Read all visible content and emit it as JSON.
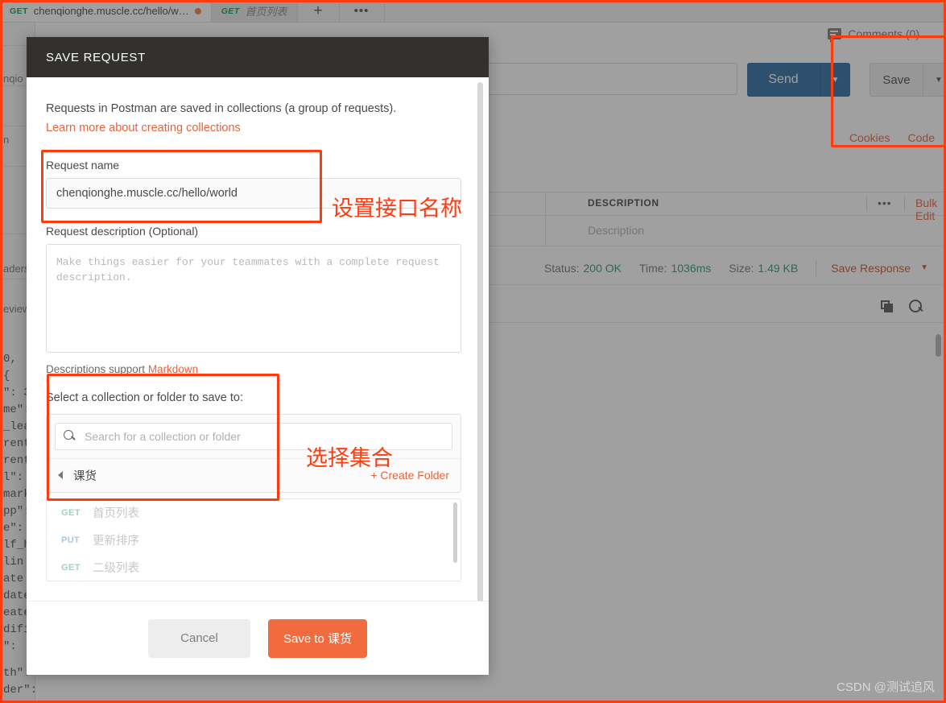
{
  "app": {
    "tabs": [
      {
        "method": "GET",
        "label": "chenqionghe.muscle.cc/hello/w…",
        "unsaved": true
      },
      {
        "method": "GET",
        "label": "首页列表",
        "unsaved": false
      }
    ],
    "new_tab_icon": "plus-icon",
    "tab_options_icon": "ellipsis-icon",
    "sidebar_fragments": [
      "nqio",
      "n",
      "aders",
      "eview"
    ],
    "url_placeholder": "",
    "send_label": "Send",
    "save_label": "Save",
    "comments_label": "Comments (0)",
    "cookies_label": "Cookies",
    "code_label": "Code",
    "table": {
      "header_description": "DESCRIPTION",
      "header_more": "•••",
      "bulk_edit": "Bulk Edit",
      "row_description_placeholder": "Description"
    },
    "status": {
      "status_label": "Status:",
      "status_value": "200 OK",
      "time_label": "Time:",
      "time_value": "1036ms",
      "size_label": "Size:",
      "size_value": "1.49 KB",
      "save_response": "Save Response"
    },
    "response_tools": {
      "copy_icon": "copy-icon",
      "search_icon": "search-icon"
    },
    "code_fragments": [
      "0,",
      "{",
      "\": 3",
      "me\":",
      "_lea",
      "rent",
      "rent",
      "l\":",
      "mark",
      "pp\":",
      "e\":",
      "lf_h",
      "lin",
      "ate",
      "date",
      "eate",
      "difi",
      "\":",
      "th\":",
      "der\":"
    ]
  },
  "modal": {
    "title": "SAVE REQUEST",
    "intro": "Requests in Postman are saved in collections (a group of requests).",
    "intro_link": "Learn more about creating collections",
    "request_name_label": "Request name",
    "request_name_value": "chenqionghe.muscle.cc/hello/world",
    "request_description_label": "Request description (Optional)",
    "request_description_placeholder": "Make things easier for your teammates with a complete request description.",
    "markdown_note_prefix": "Descriptions support ",
    "markdown_link": "Markdown",
    "select_collection_label": "Select a collection or folder to save to:",
    "search_placeholder": "Search for a collection or folder",
    "search_icon": "search-icon",
    "collection_name": "课货",
    "collection_toggle_icon": "triangle-left-icon",
    "create_folder_label": "+ Create Folder",
    "requests": [
      {
        "method": "GET",
        "name": "首页列表"
      },
      {
        "method": "PUT",
        "name": "更新排序"
      },
      {
        "method": "GET",
        "name": "二级列表"
      }
    ],
    "cancel_label": "Cancel",
    "save_label": "Save to 课货"
  },
  "annotations": {
    "set_api_name": "设置接口名称",
    "select_collection": "选择集合"
  },
  "watermark": "CSDN @测试追风",
  "colors": {
    "accent_orange": "#e8643c",
    "save_button_orange": "#f26b3f",
    "annotation_red": "#ff3b10",
    "send_blue": "#2e6da4",
    "status_green": "#2f9e6e",
    "modal_header": "#32312f"
  }
}
